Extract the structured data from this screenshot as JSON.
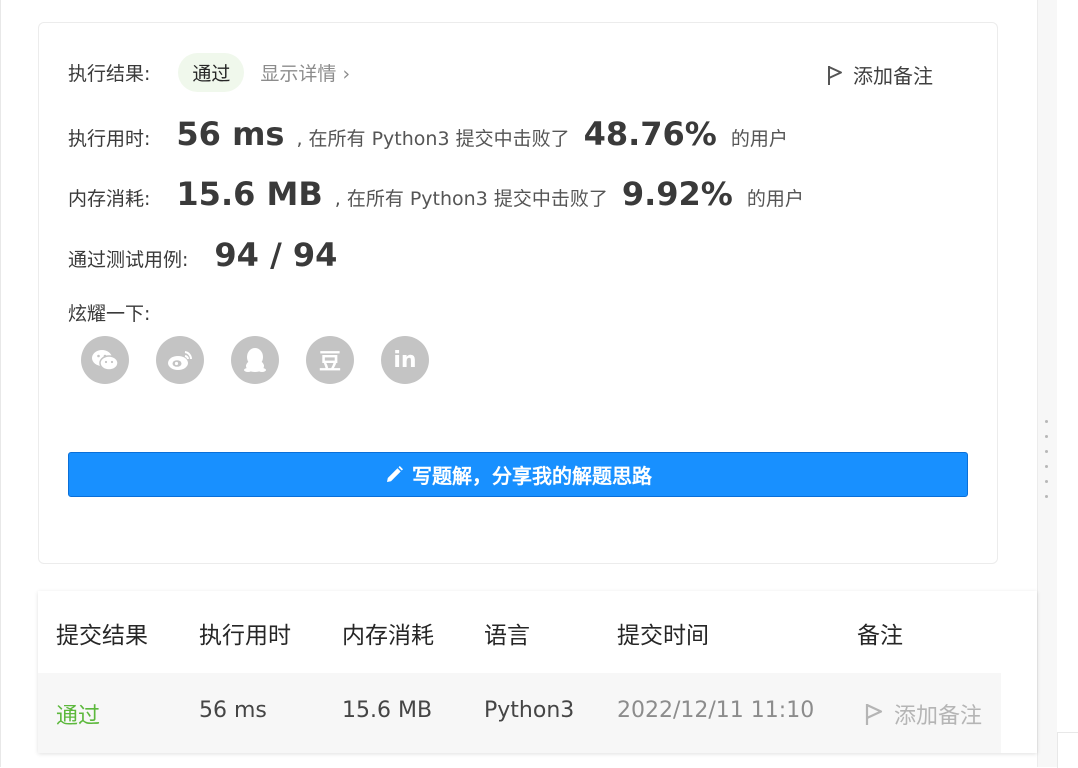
{
  "result": {
    "label": "执行结果:",
    "status": "通过",
    "details_link": "显示详情",
    "details_chevron": "›",
    "add_note": "添加备注"
  },
  "runtime": {
    "label": "执行用时:",
    "value": "56 ms",
    "middle": ", 在所有 Python3 提交中击败了",
    "percent": "48.76%",
    "suffix": "的用户"
  },
  "memory": {
    "label": "内存消耗:",
    "value": "15.6 MB",
    "middle": ", 在所有 Python3 提交中击败了",
    "percent": "9.92%",
    "suffix": "的用户"
  },
  "testcases": {
    "label": "通过测试用例:",
    "value": "94 / 94"
  },
  "share": {
    "label": "炫耀一下:",
    "icons": [
      "wechat-icon",
      "weibo-icon",
      "qq-icon",
      "douban-icon",
      "linkedin-icon"
    ],
    "douban_glyph": "豆",
    "linkedin_glyph": "in"
  },
  "write_solution": "写题解，分享我的解题思路",
  "table": {
    "headers": [
      "提交结果",
      "执行用时",
      "内存消耗",
      "语言",
      "提交时间",
      "备注"
    ],
    "row": {
      "status": "通过",
      "runtime": "56 ms",
      "memory": "15.6 MB",
      "language": "Python3",
      "time": "2022/12/11 11:10",
      "note": "添加备注"
    }
  },
  "colors": {
    "accent": "#1890ff",
    "success": "#5cb83c",
    "muted": "#b5b5b5"
  }
}
